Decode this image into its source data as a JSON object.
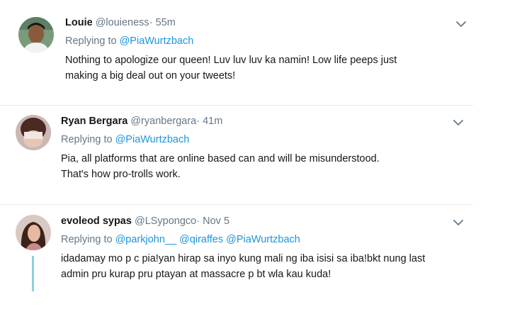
{
  "tweets": [
    {
      "name": "Louie",
      "handle": "@louieness",
      "separator": "·",
      "time": "55m",
      "replying_prefix": "Replying to",
      "replying_to": [
        "@PiaWurtzbach"
      ],
      "text_lines": [
        "Nothing to apologize our queen! Luv luv luv ka namin! Low life peeps just",
        "making a big deal out on your tweets!"
      ],
      "avatar_icon": "user-avatar-photo",
      "menu_icon": "chevron-down-icon"
    },
    {
      "name": "Ryan Bergara",
      "handle": "@ryanbergara",
      "separator": "·",
      "time": "41m",
      "replying_prefix": "Replying to",
      "replying_to": [
        "@PiaWurtzbach"
      ],
      "text_lines": [
        "Pia, all platforms that are online based can and will be misunderstood.",
        "That's how pro-trolls work."
      ],
      "avatar_icon": "user-avatar-photo",
      "menu_icon": "chevron-down-icon"
    },
    {
      "name": "evoleod sypas",
      "handle": "@LSypongco",
      "separator": "·",
      "time": "Nov 5",
      "replying_prefix": "Replying to",
      "replying_to": [
        "@parkjohn__",
        "@qiraffes",
        "@PiaWurtzbach"
      ],
      "text_lines": [
        "idadamay mo p c pia!yan hirap sa inyo kung mali ng iba isisi sa iba!bkt nung last",
        "admin pru kurap pru ptayan at massacre p bt wla kau kuda!"
      ],
      "avatar_icon": "user-avatar-photo",
      "menu_icon": "chevron-down-icon"
    }
  ],
  "colors": {
    "link": "#1b95e0",
    "muted": "#657786",
    "text": "#14171a",
    "thread_line": "#8ed0dc",
    "divider": "#e6ecf0"
  }
}
